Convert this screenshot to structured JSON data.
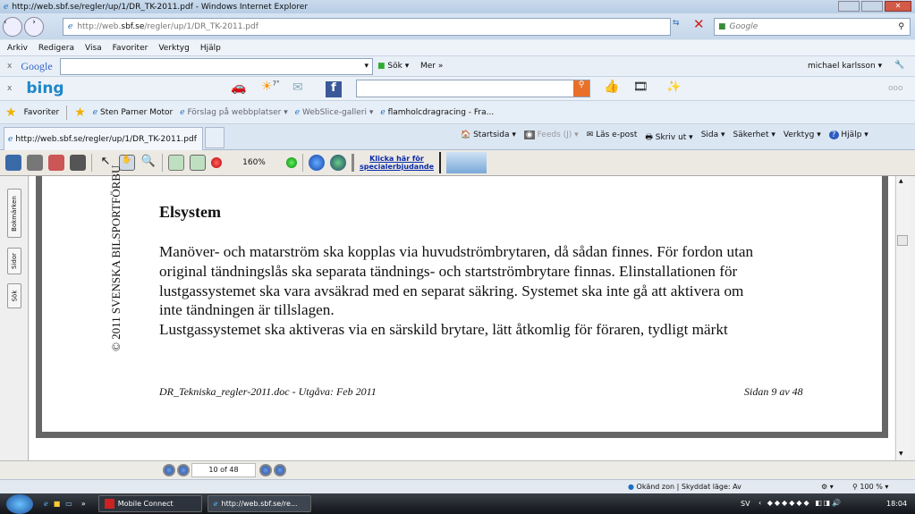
{
  "window": {
    "title": "http://web.sbf.se/regler/up/1/DR_TK-2011.pdf - Windows Internet Explorer"
  },
  "address": {
    "url_prefix": "http://web.",
    "url_domain": "sbf.se",
    "url_rest": "/regler/up/1/DR_TK-2011.pdf",
    "search_placeholder": "Google"
  },
  "menu": [
    "Arkiv",
    "Redigera",
    "Visa",
    "Favoriter",
    "Verktyg",
    "Hjälp"
  ],
  "google_bar": {
    "logo": "Google",
    "search_label": "Sök",
    "more_label": "Mer »",
    "user": "michael karlsson"
  },
  "bing_bar": {
    "logo": "bing",
    "weather": "7°",
    "more": "ooo"
  },
  "favorites": {
    "label": "Favoriter",
    "items": [
      "Sten Parner Motor",
      "Förslag på webbplatser ▾",
      "WebSlice-galleri ▾",
      "flamholcdragracing - Fra..."
    ]
  },
  "tab": {
    "label": "http://web.sbf.se/regler/up/1/DR_TK-2011.pdf"
  },
  "command_bar": [
    "Startsida ▾",
    "Feeds (J) ▾",
    "Läs e-post",
    "Skriv ut ▾",
    "Sida ▾",
    "Säkerhet ▾",
    "Verktyg ▾",
    "Hjälp ▾"
  ],
  "acrobat": {
    "zoom": "160%",
    "ad_line1": "Klicka här för",
    "ad_line2": "specialerbjudande"
  },
  "side_tabs": [
    "Bokmärken",
    "Sidor",
    "Sök"
  ],
  "document": {
    "side_text": "© 2011  SVENSKA BILSPORTFÖRBU",
    "heading": "Elsystem",
    "lines": [
      "Manöver- och matarström ska kopplas via huvudströmbrytaren, då sådan finnes. För fordon utan",
      "original tändningslås ska separata tändnings- och startströmbrytare finnas. Elinstallationen för",
      "lustgassystemet ska vara avsäkrad med en separat säkring. Systemet ska inte gå att aktivera om",
      "inte tändningen är tillslagen.",
      "Lustgassystemet ska aktiveras via en särskild brytare, lätt åtkomlig för föraren, tydligt märkt"
    ],
    "footer_left": "DR_Tekniska_regler-2011.doc - Utgåva: Feb 2011",
    "footer_right": "Sidan 9 av 48"
  },
  "page_nav": {
    "value": "10 of 48"
  },
  "status": {
    "zone": "Okänd zon | Skyddat läge: Av",
    "zoom": "100 %"
  },
  "taskbar": {
    "items": [
      "Mobile Connect",
      "http://web.sbf.se/re..."
    ],
    "lang": "SV",
    "time": "18:04"
  }
}
